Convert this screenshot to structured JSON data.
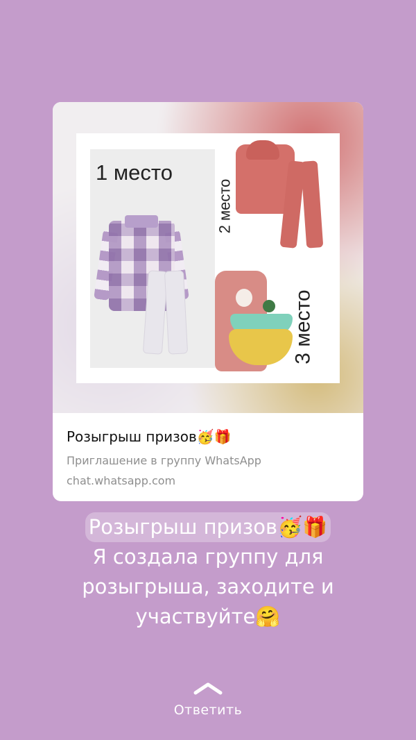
{
  "link_preview": {
    "image": {
      "place_1_label": "1 место",
      "place_2_label": "2 место",
      "place_3_label": "3 место"
    },
    "title": "Розыгрыш призов🥳🎁",
    "subtitle": "Приглашение в группу WhatsApp",
    "url": "chat.whatsapp.com"
  },
  "caption": {
    "line1": "Розыгрыш призов🥳🎁",
    "line2": "Я создала группу для",
    "line3": "розыгрыша, заходите и",
    "line4": "участвуйте🤗"
  },
  "reply": {
    "label": "Ответить"
  },
  "colors": {
    "background": "#c49ccb",
    "card": "#ffffff",
    "text_primary": "#111111",
    "text_secondary": "#8e8e8e"
  }
}
